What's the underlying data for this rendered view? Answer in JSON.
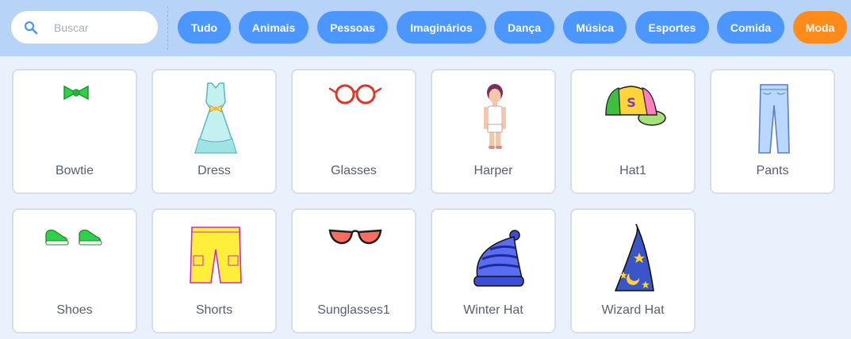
{
  "search": {
    "placeholder": "Buscar",
    "value": ""
  },
  "categories": [
    {
      "label": "Tudo"
    },
    {
      "label": "Animais"
    },
    {
      "label": "Pessoas"
    },
    {
      "label": "Imaginários"
    },
    {
      "label": "Dança"
    },
    {
      "label": "Música"
    },
    {
      "label": "Esportes"
    },
    {
      "label": "Comida"
    },
    {
      "label": "Moda",
      "selected": true
    }
  ],
  "items": [
    {
      "name": "Bowtie",
      "icon": "bowtie-icon"
    },
    {
      "name": "Dress",
      "icon": "dress-icon"
    },
    {
      "name": "Glasses",
      "icon": "glasses-icon"
    },
    {
      "name": "Harper",
      "icon": "harper-icon"
    },
    {
      "name": "Hat1",
      "icon": "cap-icon"
    },
    {
      "name": "Pants",
      "icon": "pants-icon"
    },
    {
      "name": "Shoes",
      "icon": "shoes-icon"
    },
    {
      "name": "Shorts",
      "icon": "shorts-icon"
    },
    {
      "name": "Sunglasses1",
      "icon": "sunglasses-icon"
    },
    {
      "name": "Winter Hat",
      "icon": "winter-hat-icon"
    },
    {
      "name": "Wizard Hat",
      "icon": "wizard-hat-icon"
    }
  ],
  "colors": {
    "topbar": "#b8d3f8",
    "chip": "#4c97ff",
    "chip_selected": "#ff8c1a",
    "background": "#e9f1fc",
    "label_text": "#575e75"
  }
}
